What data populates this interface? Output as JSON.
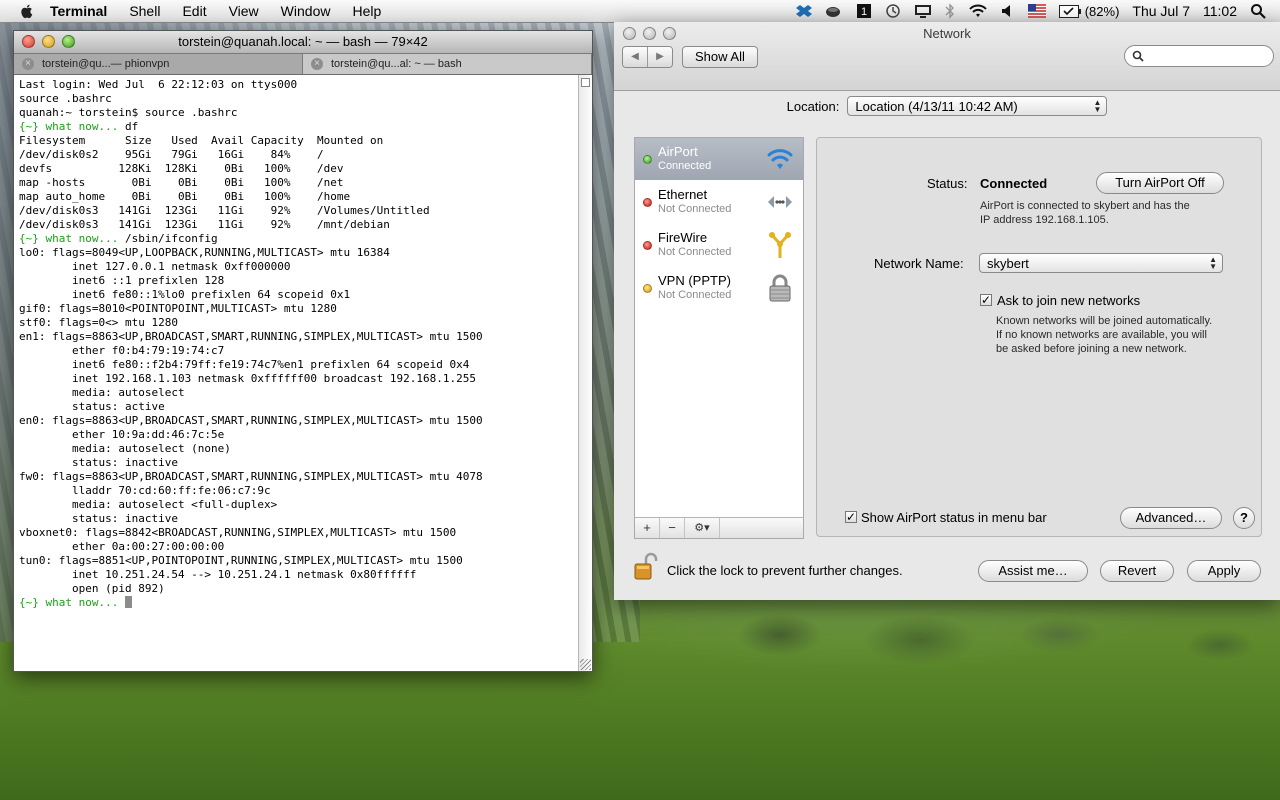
{
  "menubar": {
    "app_name": "Terminal",
    "items": [
      "Shell",
      "Edit",
      "View",
      "Window",
      "Help"
    ],
    "battery": "(82%)",
    "date": "Thu Jul 7",
    "time": "11:02"
  },
  "terminal": {
    "title": "torstein@quanah.local: ~ — bash — 79×42",
    "tabs": [
      {
        "label": "torstein@qu...— phionvpn"
      },
      {
        "label": "torstein@qu...al: ~ — bash"
      }
    ],
    "lines": [
      {
        "text": "Last login: Wed Jul  6 22:12:03 on ttys000"
      },
      {
        "text": "source .bashrc"
      },
      {
        "text": "quanah:~ torstein$ source .bashrc"
      },
      {
        "prompt": "{~} what now...",
        "text": " df"
      },
      {
        "text": "Filesystem      Size   Used  Avail Capacity  Mounted on"
      },
      {
        "text": "/dev/disk0s2    95Gi   79Gi   16Gi    84%    /"
      },
      {
        "text": "devfs          128Ki  128Ki    0Bi   100%    /dev"
      },
      {
        "text": "map -hosts       0Bi    0Bi    0Bi   100%    /net"
      },
      {
        "text": "map auto_home    0Bi    0Bi    0Bi   100%    /home"
      },
      {
        "text": "/dev/disk0s3   141Gi  123Gi   11Gi    92%    /Volumes/Untitled"
      },
      {
        "text": "/dev/disk0s3   141Gi  123Gi   11Gi    92%    /mnt/debian"
      },
      {
        "prompt": "{~} what now...",
        "text": " /sbin/ifconfig"
      },
      {
        "text": "lo0: flags=8049<UP,LOOPBACK,RUNNING,MULTICAST> mtu 16384"
      },
      {
        "text": "        inet 127.0.0.1 netmask 0xff000000"
      },
      {
        "text": "        inet6 ::1 prefixlen 128"
      },
      {
        "text": "        inet6 fe80::1%lo0 prefixlen 64 scopeid 0x1"
      },
      {
        "text": "gif0: flags=8010<POINTOPOINT,MULTICAST> mtu 1280"
      },
      {
        "text": "stf0: flags=0<> mtu 1280"
      },
      {
        "text": "en1: flags=8863<UP,BROADCAST,SMART,RUNNING,SIMPLEX,MULTICAST> mtu 1500"
      },
      {
        "text": "        ether f0:b4:79:19:74:c7"
      },
      {
        "text": "        inet6 fe80::f2b4:79ff:fe19:74c7%en1 prefixlen 64 scopeid 0x4"
      },
      {
        "text": "        inet 192.168.1.103 netmask 0xffffff00 broadcast 192.168.1.255"
      },
      {
        "text": "        media: autoselect"
      },
      {
        "text": "        status: active"
      },
      {
        "text": "en0: flags=8863<UP,BROADCAST,SMART,RUNNING,SIMPLEX,MULTICAST> mtu 1500"
      },
      {
        "text": "        ether 10:9a:dd:46:7c:5e"
      },
      {
        "text": "        media: autoselect (none)"
      },
      {
        "text": "        status: inactive"
      },
      {
        "text": "fw0: flags=8863<UP,BROADCAST,SMART,RUNNING,SIMPLEX,MULTICAST> mtu 4078"
      },
      {
        "text": "        lladdr 70:cd:60:ff:fe:06:c7:9c"
      },
      {
        "text": "        media: autoselect <full-duplex>"
      },
      {
        "text": "        status: inactive"
      },
      {
        "text": "vboxnet0: flags=8842<BROADCAST,RUNNING,SIMPLEX,MULTICAST> mtu 1500"
      },
      {
        "text": "        ether 0a:00:27:00:00:00"
      },
      {
        "text": "tun0: flags=8851<UP,POINTOPOINT,RUNNING,SIMPLEX,MULTICAST> mtu 1500"
      },
      {
        "text": "        inet 10.251.24.54 --> 10.251.24.1 netmask 0x80ffffff"
      },
      {
        "text": "        open (pid 892)"
      },
      {
        "prompt": "{~} what now...",
        "text": " ",
        "cursor": true
      }
    ]
  },
  "network": {
    "title": "Network",
    "show_all": "Show All",
    "location_label": "Location:",
    "location_value": "Location (4/13/11 10:42 AM)",
    "services": [
      {
        "name": "AirPort",
        "status": "Connected",
        "led": "green",
        "icon": "wifi-icon"
      },
      {
        "name": "Ethernet",
        "status": "Not Connected",
        "led": "red",
        "icon": "ethernet-icon"
      },
      {
        "name": "FireWire",
        "status": "Not Connected",
        "led": "red",
        "icon": "firewire-icon"
      },
      {
        "name": "VPN (PPTP)",
        "status": "Not Connected",
        "led": "yellow",
        "icon": "lock-icon"
      }
    ],
    "status_label": "Status:",
    "status_value": "Connected",
    "turn_off": "Turn AirPort Off",
    "status_desc_1": "AirPort is connected to skybert and has the",
    "status_desc_2": "IP address 192.168.1.105.",
    "network_name_label": "Network Name:",
    "network_name_value": "skybert",
    "ask_join_label": "Ask to join new networks",
    "ask_join_desc_1": "Known networks will be joined automatically.",
    "ask_join_desc_2": "If no known networks are available, you will",
    "ask_join_desc_3": "be asked before joining a new network.",
    "show_status_label": "Show AirPort status in menu bar",
    "advanced": "Advanced…",
    "help": "?",
    "lock_text": "Click the lock to prevent further changes.",
    "assist": "Assist me…",
    "revert": "Revert",
    "apply": "Apply"
  }
}
